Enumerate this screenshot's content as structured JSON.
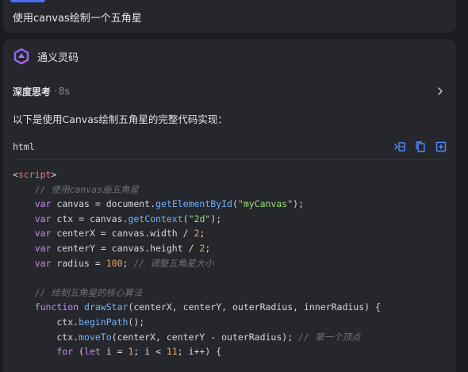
{
  "user_message": "使用canvas绘制一个五角星",
  "assistant": {
    "name": "通义灵码",
    "thinking_label": "深度思考",
    "thinking_time": "8s",
    "intro": "以下是使用Canvas绘制五角星的完整代码实现："
  },
  "code_block": {
    "language": "html",
    "tools": [
      "insert-icon",
      "copy-icon",
      "new-file-icon"
    ],
    "lines": [
      [
        {
          "t": "<",
          "c": "op"
        },
        {
          "t": "script",
          "c": "tag"
        },
        {
          "t": ">",
          "c": "op"
        }
      ],
      [
        {
          "t": "    // 使用canvas画五角星",
          "c": "com"
        }
      ],
      [
        {
          "t": "    ",
          "c": "op"
        },
        {
          "t": "var",
          "c": "kw"
        },
        {
          "t": " canvas = document.",
          "c": "op"
        },
        {
          "t": "getElementById",
          "c": "fn"
        },
        {
          "t": "(",
          "c": "op"
        },
        {
          "t": "\"myCanvas\"",
          "c": "str"
        },
        {
          "t": ");",
          "c": "op"
        }
      ],
      [
        {
          "t": "    ",
          "c": "op"
        },
        {
          "t": "var",
          "c": "kw"
        },
        {
          "t": " ctx = canvas.",
          "c": "op"
        },
        {
          "t": "getContext",
          "c": "fn"
        },
        {
          "t": "(",
          "c": "op"
        },
        {
          "t": "\"2d\"",
          "c": "str"
        },
        {
          "t": ");",
          "c": "op"
        }
      ],
      [
        {
          "t": "    ",
          "c": "op"
        },
        {
          "t": "var",
          "c": "kw"
        },
        {
          "t": " centerX = canvas.width / ",
          "c": "op"
        },
        {
          "t": "2",
          "c": "num"
        },
        {
          "t": ";",
          "c": "op"
        }
      ],
      [
        {
          "t": "    ",
          "c": "op"
        },
        {
          "t": "var",
          "c": "kw"
        },
        {
          "t": " centerY = canvas.height / ",
          "c": "op"
        },
        {
          "t": "2",
          "c": "num"
        },
        {
          "t": ";",
          "c": "op"
        }
      ],
      [
        {
          "t": "    ",
          "c": "op"
        },
        {
          "t": "var",
          "c": "kw"
        },
        {
          "t": " radius = ",
          "c": "op"
        },
        {
          "t": "100",
          "c": "num"
        },
        {
          "t": "; ",
          "c": "op"
        },
        {
          "t": "// 调整五角星大小",
          "c": "com"
        }
      ],
      [
        {
          "t": "",
          "c": "op"
        }
      ],
      [
        {
          "t": "    // 绘制五角星的核心算法",
          "c": "com"
        }
      ],
      [
        {
          "t": "    ",
          "c": "op"
        },
        {
          "t": "function",
          "c": "kw"
        },
        {
          "t": " ",
          "c": "op"
        },
        {
          "t": "drawStar",
          "c": "fn"
        },
        {
          "t": "(centerX, centerY, outerRadius, innerRadius) {",
          "c": "op"
        }
      ],
      [
        {
          "t": "        ctx.",
          "c": "op"
        },
        {
          "t": "beginPath",
          "c": "fn"
        },
        {
          "t": "();",
          "c": "op"
        }
      ],
      [
        {
          "t": "        ctx.",
          "c": "op"
        },
        {
          "t": "moveTo",
          "c": "fn"
        },
        {
          "t": "(centerX, centerY - outerRadius); ",
          "c": "op"
        },
        {
          "t": "// 第一个顶点",
          "c": "com"
        }
      ],
      [
        {
          "t": "        ",
          "c": "op"
        },
        {
          "t": "for",
          "c": "kw"
        },
        {
          "t": " (",
          "c": "op"
        },
        {
          "t": "let",
          "c": "kw"
        },
        {
          "t": " i = ",
          "c": "op"
        },
        {
          "t": "1",
          "c": "num"
        },
        {
          "t": "; i < ",
          "c": "op"
        },
        {
          "t": "11",
          "c": "num"
        },
        {
          "t": "; i++) {",
          "c": "op"
        }
      ]
    ]
  },
  "colors": {
    "background": "#1b1c20",
    "card": "#26272c",
    "accent": "#4c6ef5",
    "keyword": "#c98bf0",
    "function": "#6fb2ff",
    "string": "#9be071",
    "number": "#e8a866",
    "comment": "#6d7079"
  }
}
